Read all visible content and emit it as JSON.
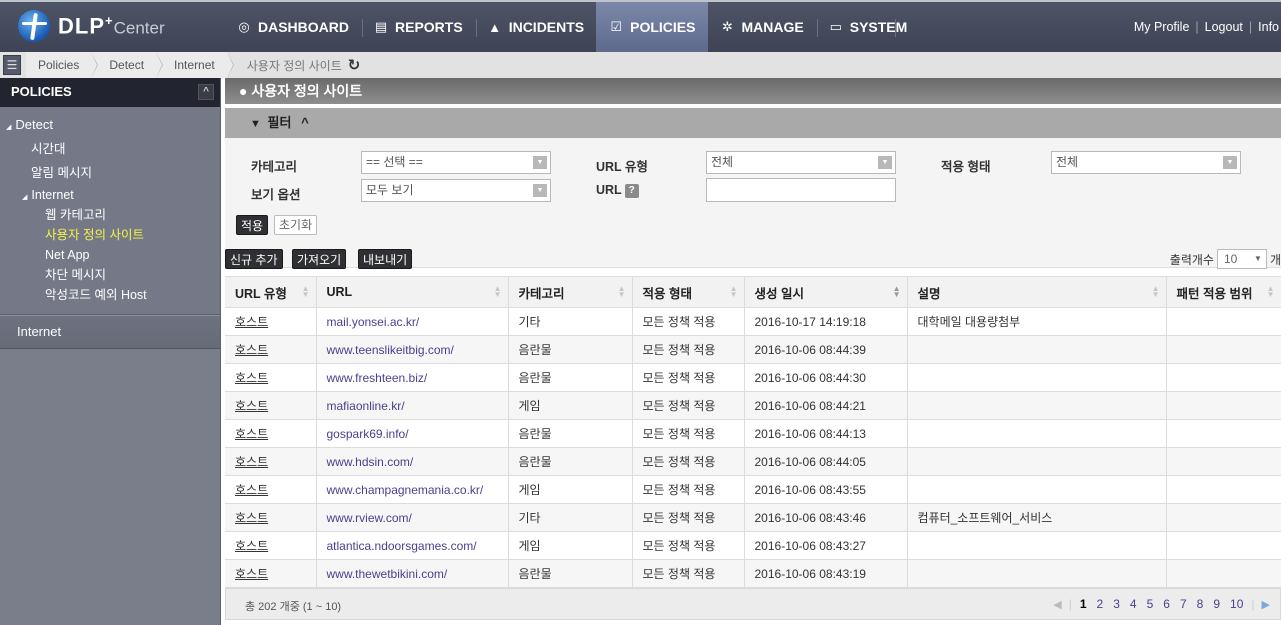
{
  "app": {
    "logo_main": "DLP",
    "logo_plus": "+",
    "logo_sub": "Center"
  },
  "nav": {
    "items": [
      {
        "label": "DASHBOARD",
        "icon": "dashboard-icon",
        "glyph": "◎"
      },
      {
        "label": "REPORTS",
        "icon": "reports-icon",
        "glyph": "▤"
      },
      {
        "label": "INCIDENTS",
        "icon": "warning-icon",
        "glyph": "▲"
      },
      {
        "label": "POLICIES",
        "icon": "clipboard-icon",
        "glyph": "☑"
      },
      {
        "label": "MANAGE",
        "icon": "gear-icon",
        "glyph": "✲"
      },
      {
        "label": "SYSTEM",
        "icon": "monitor-icon",
        "glyph": "▭"
      }
    ],
    "active": "POLICIES",
    "user_links": {
      "profile": "My Profile",
      "logout": "Logout",
      "info": "Info",
      "separator": "|"
    }
  },
  "breadcrumb": {
    "items": [
      "Policies",
      "Detect",
      "Internet"
    ],
    "current": "사용자 정의 사이트",
    "refresh_glyph": "↻"
  },
  "sidebar": {
    "title": "POLICIES",
    "collapse_glyph": "^",
    "tree": {
      "detect": "Detect",
      "time_zone": "시간대",
      "alert_message": "알림 메시지",
      "internet": "Internet",
      "web_category": "웹 카테고리",
      "custom_sites": "사용자 정의 사이트",
      "net_app": "Net App",
      "block_message": "차단 메시지",
      "malware_exception": "악성코드 예외 Host"
    },
    "section": "Internet"
  },
  "page": {
    "title": "● 사용자 정의 사이트"
  },
  "filter": {
    "header": "필터",
    "filter_glyph": "▼",
    "toggle_glyph": "^",
    "category_label": "카테고리",
    "category_value": "== 선택 ==",
    "view_option_label": "보기 옵션",
    "view_option_value": "모두 보기",
    "url_type_label": "URL 유형",
    "url_type_value": "전체",
    "url_label": "URL",
    "url_help": "?",
    "url_value": "",
    "apply_type_label": "적용 형태",
    "apply_type_value": "전체",
    "apply_button": "적용",
    "reset_button": "초기화"
  },
  "toolbar": {
    "add_button": "신규 추가",
    "import_button": "가져오기",
    "export_button": "내보내기",
    "page_size_label": "출력개수",
    "page_size_value": "10",
    "page_size_suffix": "개"
  },
  "table": {
    "columns": [
      "URL 유형",
      "URL",
      "카테고리",
      "적용 형태",
      "생성 일시",
      "설명",
      "패턴 적용 범위"
    ],
    "rows": [
      {
        "type": "호스트",
        "url": "mail.yonsei.ac.kr/",
        "category": "기타",
        "apply": "모든 정책 적용",
        "created": "2016-10-17 14:19:18",
        "desc": "대학메일 대용량첨부",
        "scope": ""
      },
      {
        "type": "호스트",
        "url": "www.teenslikeitbig.com/",
        "category": "음란물",
        "apply": "모든 정책 적용",
        "created": "2016-10-06 08:44:39",
        "desc": "",
        "scope": ""
      },
      {
        "type": "호스트",
        "url": "www.freshteen.biz/",
        "category": "음란물",
        "apply": "모든 정책 적용",
        "created": "2016-10-06 08:44:30",
        "desc": "",
        "scope": ""
      },
      {
        "type": "호스트",
        "url": "mafiaonline.kr/",
        "category": "게임",
        "apply": "모든 정책 적용",
        "created": "2016-10-06 08:44:21",
        "desc": "",
        "scope": ""
      },
      {
        "type": "호스트",
        "url": "gospark69.info/",
        "category": "음란물",
        "apply": "모든 정책 적용",
        "created": "2016-10-06 08:44:13",
        "desc": "",
        "scope": ""
      },
      {
        "type": "호스트",
        "url": "www.hdsin.com/",
        "category": "음란물",
        "apply": "모든 정책 적용",
        "created": "2016-10-06 08:44:05",
        "desc": "",
        "scope": ""
      },
      {
        "type": "호스트",
        "url": "www.champagnemania.co.kr/",
        "category": "게임",
        "apply": "모든 정책 적용",
        "created": "2016-10-06 08:43:55",
        "desc": "",
        "scope": ""
      },
      {
        "type": "호스트",
        "url": "www.rview.com/",
        "category": "기타",
        "apply": "모든 정책 적용",
        "created": "2016-10-06 08:43:46",
        "desc": "컴퓨터_소프트웨어_서비스",
        "scope": ""
      },
      {
        "type": "호스트",
        "url": "atlantica.ndoorsgames.com/",
        "category": "게임",
        "apply": "모든 정책 적용",
        "created": "2016-10-06 08:43:27",
        "desc": "",
        "scope": ""
      },
      {
        "type": "호스트",
        "url": "www.thewetbikini.com/",
        "category": "음란물",
        "apply": "모든 정책 적용",
        "created": "2016-10-06 08:43:19",
        "desc": "",
        "scope": ""
      }
    ]
  },
  "footer": {
    "total": "총 202 개중 (1 ~ 10)",
    "pages": [
      "1",
      "2",
      "3",
      "4",
      "5",
      "6",
      "7",
      "8",
      "9",
      "10"
    ],
    "current_page": "1",
    "prev_glyph": "◀",
    "next_glyph": "▶"
  }
}
